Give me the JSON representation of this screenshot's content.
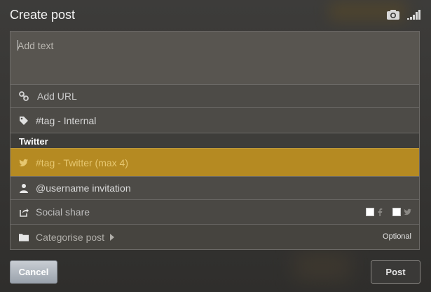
{
  "header": {
    "title": "Create post",
    "camera_icon": "camera-icon",
    "signal_icon": "signal-icon"
  },
  "composer": {
    "placeholder": "Add text"
  },
  "rows": {
    "add_url": {
      "label": "Add URL",
      "icon": "link-icon"
    },
    "internal_tag": {
      "label": "#tag - Internal",
      "icon": "tag-icon"
    },
    "twitter_section": "Twitter",
    "twitter_tag": {
      "label": "#tag - Twitter (max 4)",
      "icon": "twitter-bird-icon"
    },
    "username_invite": {
      "label": "@username invitation",
      "icon": "user-icon"
    },
    "social_share": {
      "label": "Social share",
      "icon": "share-icon",
      "facebook_checked": false,
      "twitter_checked": false
    },
    "categorise": {
      "label": "Categorise post",
      "icon": "folder-icon",
      "note": "Optional"
    }
  },
  "buttons": {
    "cancel": "Cancel",
    "post": "Post"
  },
  "colors": {
    "accent": "#b58a22",
    "accent_text": "#e6c770"
  }
}
